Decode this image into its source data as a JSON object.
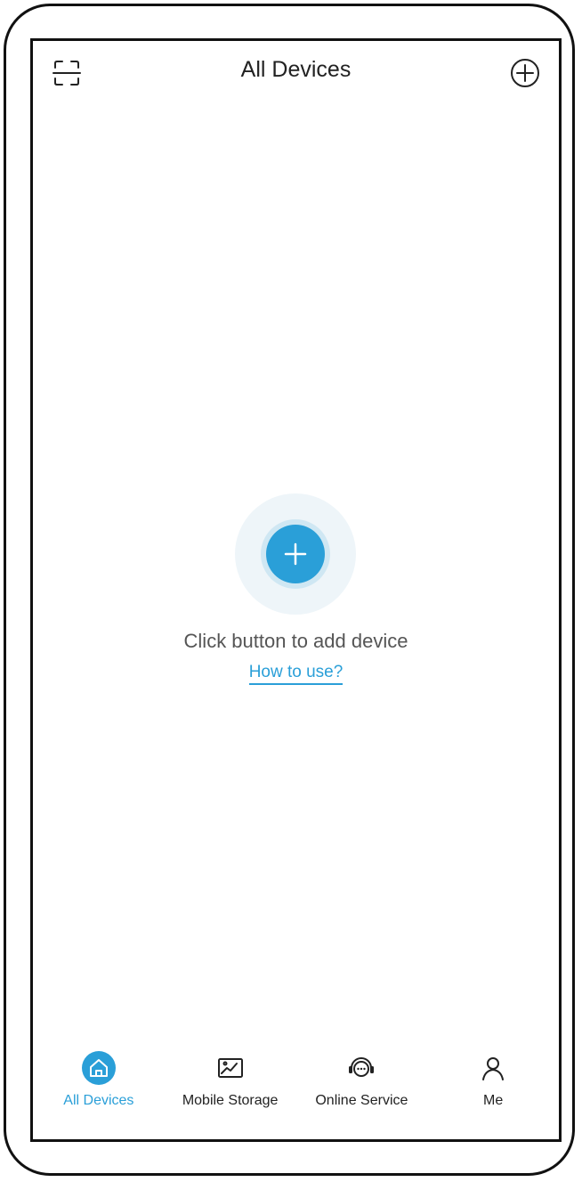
{
  "header": {
    "title": "All Devices",
    "scan_icon": "scan-icon",
    "add_icon": "add-circle-icon"
  },
  "empty_state": {
    "message": "Click button to add device",
    "help_link": "How to use?",
    "add_icon": "plus-icon"
  },
  "tabbar": {
    "items": [
      {
        "label": "All Devices",
        "icon": "home-icon",
        "active": true
      },
      {
        "label": "Mobile Storage",
        "icon": "gallery-icon",
        "active": false
      },
      {
        "label": "Online Service",
        "icon": "headset-chat-icon",
        "active": false
      },
      {
        "label": "Me",
        "icon": "person-icon",
        "active": false
      }
    ]
  },
  "colors": {
    "accent": "#2a9fd8",
    "text": "#222222",
    "muted_text": "#555555",
    "halo": "#eef5f9",
    "ring": "#cfe7f3"
  }
}
